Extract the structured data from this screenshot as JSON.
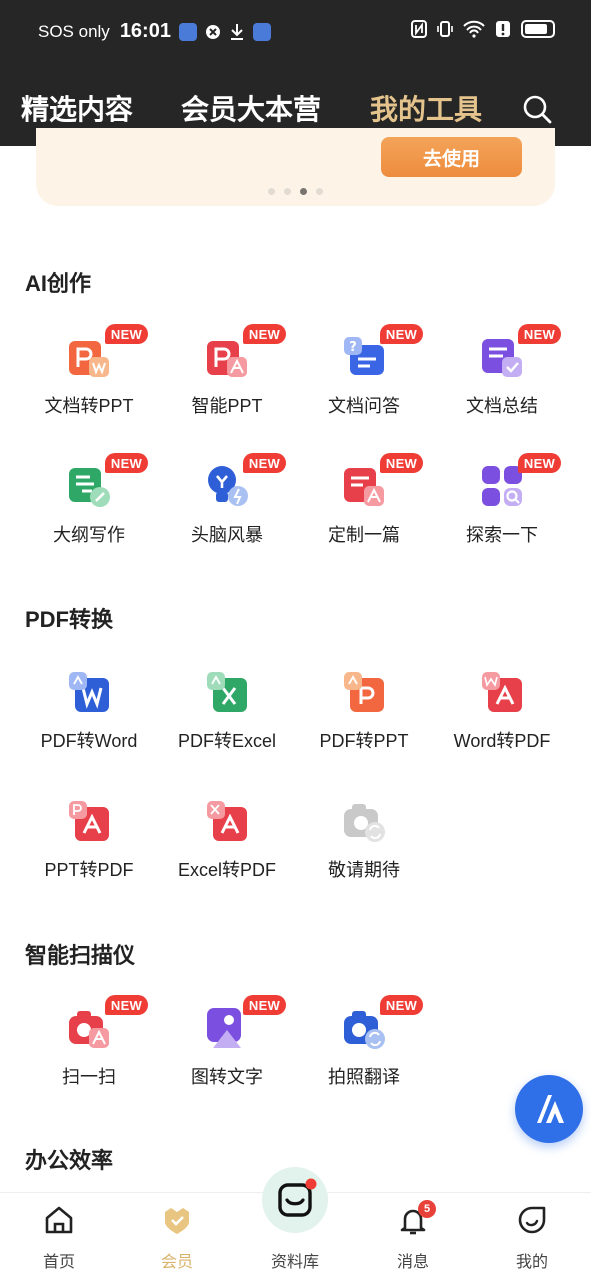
{
  "status_bar": {
    "carrier": "SOS only",
    "time": "16:01"
  },
  "nav": {
    "tabs": [
      "精选内容",
      "会员大本营",
      "我的工具"
    ],
    "active_tab": "我的工具"
  },
  "banner": {
    "button_label": "去使用",
    "page_count": 4,
    "active_page": 3
  },
  "colors": {
    "header_bg": "#262626",
    "active_tab": "#e4c48c",
    "new_badge": "#ef3d36",
    "banner_button": "#ee8c3e",
    "fab": "#2f6fe8"
  },
  "sections": {
    "ai": {
      "title": "AI创作",
      "tools": [
        {
          "label": "文档转PPT",
          "badge": "NEW",
          "icon": "doc-to-ppt-icon"
        },
        {
          "label": "智能PPT",
          "badge": "NEW",
          "icon": "smart-ppt-icon"
        },
        {
          "label": "文档问答",
          "badge": "NEW",
          "icon": "doc-qa-icon"
        },
        {
          "label": "文档总结",
          "badge": "NEW",
          "icon": "doc-summary-icon"
        },
        {
          "label": "大纲写作",
          "badge": "NEW",
          "icon": "outline-writing-icon"
        },
        {
          "label": "头脑风暴",
          "badge": "NEW",
          "icon": "brainstorm-icon"
        },
        {
          "label": "定制一篇",
          "badge": "NEW",
          "icon": "custom-article-icon"
        },
        {
          "label": "探索一下",
          "badge": "NEW",
          "icon": "explore-icon"
        }
      ]
    },
    "pdf": {
      "title": "PDF转换",
      "tools": [
        {
          "label": "PDF转Word",
          "icon": "pdf-to-word-icon"
        },
        {
          "label": "PDF转Excel",
          "icon": "pdf-to-excel-icon"
        },
        {
          "label": "PDF转PPT",
          "icon": "pdf-to-ppt-icon"
        },
        {
          "label": "Word转PDF",
          "icon": "word-to-pdf-icon"
        },
        {
          "label": "PPT转PDF",
          "icon": "ppt-to-pdf-icon"
        },
        {
          "label": "Excel转PDF",
          "icon": "excel-to-pdf-icon"
        },
        {
          "label": "敬请期待",
          "icon": "coming-soon-icon"
        }
      ]
    },
    "scanner": {
      "title": "智能扫描仪",
      "tools": [
        {
          "label": "扫一扫",
          "badge": "NEW",
          "icon": "scan-icon"
        },
        {
          "label": "图转文字",
          "badge": "NEW",
          "icon": "image-to-text-icon"
        },
        {
          "label": "拍照翻译",
          "badge": "NEW",
          "icon": "photo-translate-icon"
        }
      ]
    },
    "office": {
      "title": "办公效率"
    }
  },
  "bottom_nav": {
    "items": [
      "首页",
      "会员",
      "资料库",
      "消息",
      "我的"
    ],
    "active": "会员",
    "message_badge": "5"
  }
}
